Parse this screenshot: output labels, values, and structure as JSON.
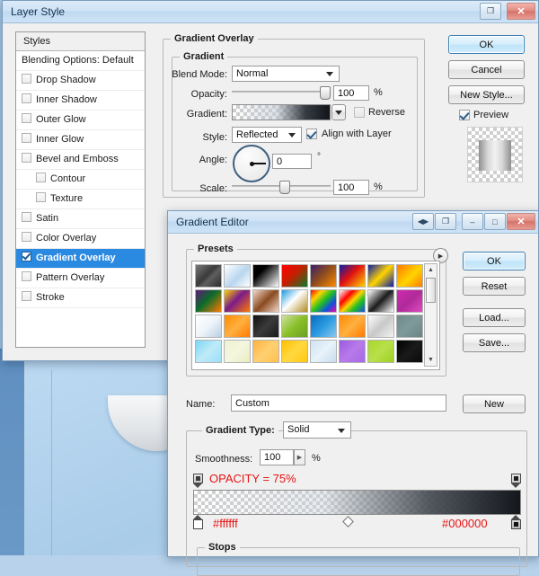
{
  "desktop": {
    "label": "photoshop-canvas-background"
  },
  "layer_style": {
    "title": "Layer Style",
    "window_buttons": [
      {
        "name": "restore-icon",
        "glyph": "❐"
      },
      {
        "name": "close-icon",
        "glyph": "✕"
      }
    ],
    "styles_panel": {
      "header": "Styles",
      "blending_options": "Blending Options: Default",
      "items": [
        {
          "label": "Drop Shadow",
          "checked": false,
          "indent": false
        },
        {
          "label": "Inner Shadow",
          "checked": false,
          "indent": false
        },
        {
          "label": "Outer Glow",
          "checked": false,
          "indent": false
        },
        {
          "label": "Inner Glow",
          "checked": false,
          "indent": false
        },
        {
          "label": "Bevel and Emboss",
          "checked": false,
          "indent": false
        },
        {
          "label": "Contour",
          "checked": false,
          "indent": true
        },
        {
          "label": "Texture",
          "checked": false,
          "indent": true
        },
        {
          "label": "Satin",
          "checked": false,
          "indent": false
        },
        {
          "label": "Color Overlay",
          "checked": false,
          "indent": false
        },
        {
          "label": "Gradient Overlay",
          "checked": true,
          "indent": false,
          "selected": true
        },
        {
          "label": "Pattern Overlay",
          "checked": false,
          "indent": false
        },
        {
          "label": "Stroke",
          "checked": false,
          "indent": false
        }
      ]
    },
    "panel": {
      "title": "Gradient Overlay",
      "group_title": "Gradient",
      "blend_mode_label": "Blend Mode:",
      "blend_mode_value": "Normal",
      "opacity_label": "Opacity:",
      "opacity_value": "100",
      "opacity_unit": "%",
      "gradient_label": "Gradient:",
      "reverse_label": "Reverse",
      "reverse_checked": false,
      "style_label": "Style:",
      "style_value": "Reflected",
      "align_label": "Align with Layer",
      "align_checked": true,
      "angle_label": "Angle:",
      "angle_value": "0",
      "angle_unit": "°",
      "scale_label": "Scale:",
      "scale_value": "100",
      "scale_unit": "%"
    },
    "buttons": {
      "ok": "OK",
      "cancel": "Cancel",
      "new_style": "New Style...",
      "preview": "Preview",
      "preview_checked": true
    }
  },
  "gradient_editor": {
    "title": "Gradient Editor",
    "window_buttons": [
      {
        "name": "collapse-icon",
        "glyph": "◀▶"
      },
      {
        "name": "dock-icon",
        "glyph": "❐"
      },
      {
        "name": "minimize-icon",
        "glyph": "–"
      },
      {
        "name": "maximize-icon",
        "glyph": "□"
      },
      {
        "name": "close-icon",
        "glyph": "✕"
      }
    ],
    "presets_label": "Presets",
    "presets": [
      "linear-gradient(135deg,#7a7a7a,#3a3a3a 45%,#5f5f5f 60%,#2b2b2b)",
      "linear-gradient(135deg,#ffffff,#b9d6ef 55%,#ffffff)",
      "linear-gradient(135deg,#000000,#000000 30%,#ffffff)",
      "linear-gradient(135deg,#ff0000,#c81e00 45%,#0b7a2a)",
      "linear-gradient(135deg,#3a1f6b,#8a4a20 45%,#ff8a00)",
      "linear-gradient(135deg,#0b1ea8,#e01010 45%,#ffd400)",
      "linear-gradient(135deg,#0b1ea8,#ffd400 50%,#0b1ea8)",
      "linear-gradient(135deg,#ff7a00,#ffd400 55%,#ff7a00)",
      "linear-gradient(135deg,#5d1b7a,#0b6b2a 45%,#ff7a00)",
      "linear-gradient(135deg,#ffd400,#7a1b8a 45%,#ff7a00)",
      "linear-gradient(135deg,#f3d8c8,#8a4a20 50%,#f3d8c8)",
      "linear-gradient(135deg,#1e9ae0,#ffffff 45%,#b08a20)",
      "linear-gradient(135deg,#ff0000,#ffd400 25%,#22c020 50%,#1050e0 75%,#ff00a0)",
      "linear-gradient(135deg,#ffffff,#ff0000 30%,#ffd400 50%,#22c020 70%,#1050e0)",
      "linear-gradient(135deg,#ffffff,#1b1b1b 50%,#ffffff)",
      "linear-gradient(135deg,#d02ab0,#b02a9a 50%,#e04ac0)",
      "linear-gradient(135deg,#ffffff,#eef4fa 50%,#b9cfe2)",
      "linear-gradient(135deg,#ff8a00,#ffb040 50%,#ff7a00)",
      "linear-gradient(135deg,#101010,#3a3a3a 50%,#1a1a1a)",
      "linear-gradient(135deg,#cfe0a0,#8ac02a 50%,#6aa020)",
      "linear-gradient(135deg,#0b6ac0,#2a9ae0 50%,#8ac8ef)",
      "linear-gradient(135deg,#ff8a00,#ffb040 50%,#ff7a00)",
      "linear-gradient(135deg,#ffffff,#c8c8c8 50%,#f2f2f2)",
      "linear-gradient(135deg,#6f8a8a,#7f9a9a 50%,#6a8585)",
      "linear-gradient(135deg,#7ad6f5,#bfeaf8 50%,#9ae0f7)",
      "linear-gradient(135deg,#eef2cf,#f4f6df 50%,#e8eec0)",
      "linear-gradient(135deg,#ffb040,#ffd070 50%,#ffc050)",
      "linear-gradient(135deg,#ffc000,#ffd840 50%,#ffc810)",
      "linear-gradient(135deg,#cfe2f0,#e8f2fa 50%,#c8dcee)",
      "linear-gradient(135deg,#9a5ae0,#b87aea 50%,#a46ae6)",
      "linear-gradient(135deg,#a8d82a,#b8e04a 50%,#9ed020)",
      "linear-gradient(135deg,#000000,#1a1a1a 50%,#0a0a0a)"
    ],
    "buttons": {
      "ok": "OK",
      "reset": "Reset",
      "load": "Load...",
      "save": "Save...",
      "new": "New"
    },
    "name_label": "Name:",
    "name_value": "Custom",
    "gradient_type_label": "Gradient Type:",
    "gradient_type_value": "Solid",
    "smoothness_label": "Smoothness:",
    "smoothness_value": "100",
    "smoothness_unit": "%",
    "opacity_note": "OPACITY = 75%",
    "left_stop_color": "#ffffff",
    "right_stop_color": "#000000",
    "stops_label": "Stops",
    "annotation_color": "#e81313"
  }
}
